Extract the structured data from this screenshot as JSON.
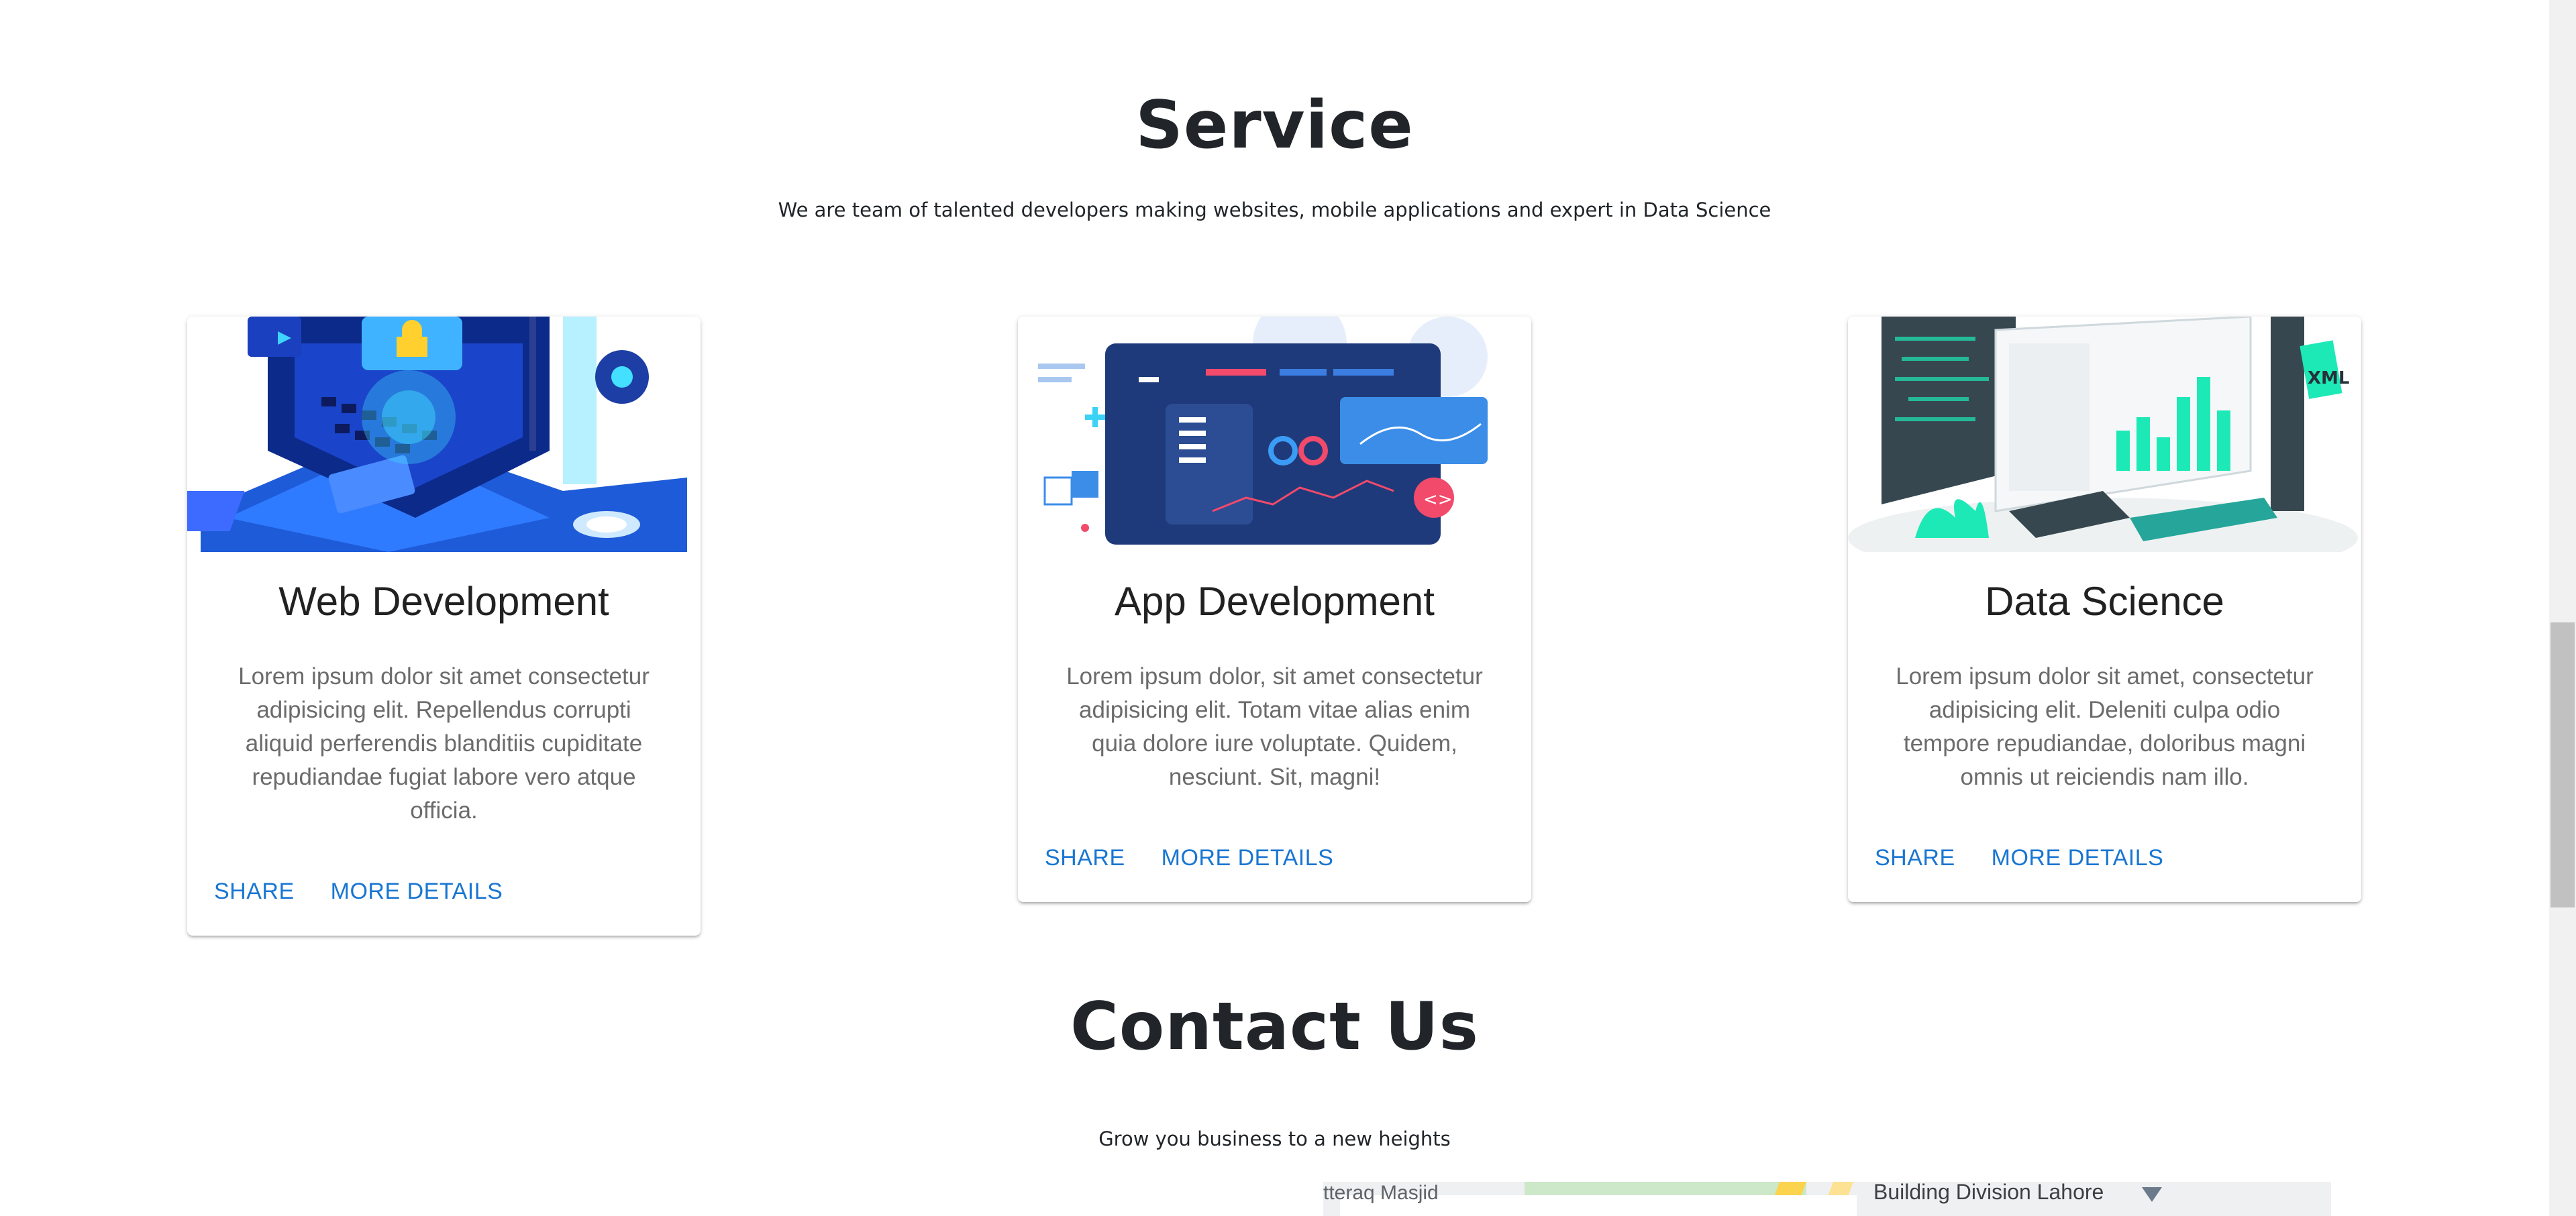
{
  "service": {
    "title": "Service",
    "subtitle": "We are team of talented developers making websites, mobile applications and expert in Data Science"
  },
  "cards": [
    {
      "title": "Web Development",
      "text": "Lorem ipsum dolor sit amet consectetur adipisicing elit. Repellendus corrupti aliquid perferendis blanditiis cupiditate repudiandae fugiat labore vero atque officia.",
      "share": "SHARE",
      "more": "MORE DETAILS"
    },
    {
      "title": "App Development",
      "text": "Lorem ipsum dolor, sit amet consectetur adipisicing elit. Totam vitae alias enim quia dolore iure voluptate. Quidem, nesciunt. Sit, magni!",
      "share": "SHARE",
      "more": "MORE DETAILS"
    },
    {
      "title": "Data Science",
      "text": "Lorem ipsum dolor sit amet, consectetur adipisicing elit. Deleniti culpa odio tempore repudiandae, doloribus magni omnis ut reiciendis nam illo.",
      "share": "SHARE",
      "more": "MORE DETAILS"
    }
  ],
  "contact": {
    "title": "Contact Us",
    "subtitle": "Grow you business to a new heights"
  },
  "map": {
    "label_left": "tteraq Masjid",
    "label_right": "Building Division Lahore"
  },
  "colors": {
    "primary": "#1976d2",
    "text": "#212529",
    "muted": "#6b6b6b"
  }
}
